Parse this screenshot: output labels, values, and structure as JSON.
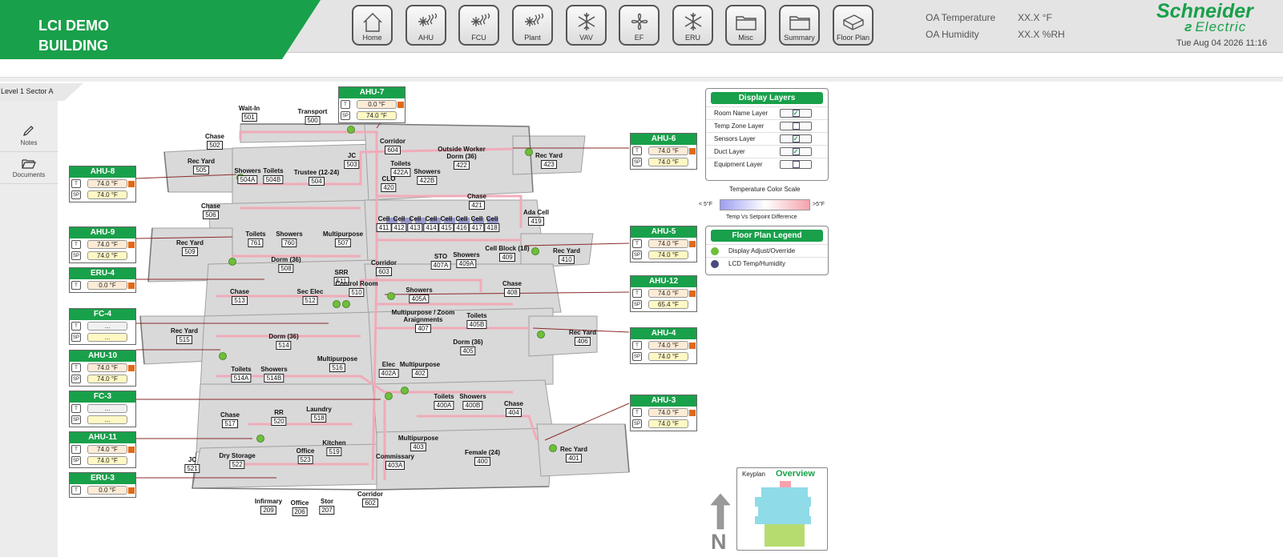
{
  "brand": {
    "line1": "LCI DEMO",
    "line2": "BUILDING"
  },
  "nav": [
    {
      "label": "Home",
      "icon": "home-icon"
    },
    {
      "label": "AHU",
      "icon": "snowflake-heat-icon"
    },
    {
      "label": "FCU",
      "icon": "snowflake-heat-icon"
    },
    {
      "label": "Plant",
      "icon": "snowflake-heat-icon"
    },
    {
      "label": "VAV",
      "icon": "snowflake-icon"
    },
    {
      "label": "EF",
      "icon": "fan-icon"
    },
    {
      "label": "ERU",
      "icon": "snowflake-icon"
    },
    {
      "label": "Misc",
      "icon": "folder-icon"
    },
    {
      "label": "Summary",
      "icon": "folder-icon"
    },
    {
      "label": "Floor Plan",
      "icon": "floor-plan-icon"
    }
  ],
  "oa": {
    "temp_label": "OA Temperature",
    "temp_value": "XX.X °F",
    "hum_label": "OA Humidity",
    "hum_value": "XX.X %RH"
  },
  "logo": {
    "line1": "Schneider",
    "line2": "Electric"
  },
  "datetime": "Tue Aug 04 2026 11:16",
  "breadcrumb": "Level 1 Sector A",
  "side": [
    {
      "label": "Notes",
      "icon": "pencil-icon"
    },
    {
      "label": "Documents",
      "icon": "folder-open-icon"
    }
  ],
  "equipment": [
    {
      "id": "ahu7",
      "name": "AHU-7",
      "t": "0.0 °F",
      "sp": "74.0 °F"
    },
    {
      "id": "ahu8",
      "name": "AHU-8",
      "t": "74.0 °F",
      "sp": "74.0 °F"
    },
    {
      "id": "ahu9",
      "name": "AHU-9",
      "t": "74.0 °F",
      "sp": "74.0 °F"
    },
    {
      "id": "eru4",
      "name": "ERU-4",
      "t": "0.0 °F"
    },
    {
      "id": "fc4",
      "name": "FC-4",
      "t": "...",
      "sp": "..."
    },
    {
      "id": "ahu10",
      "name": "AHU-10",
      "t": "74.0 °F",
      "sp": "74.0 °F"
    },
    {
      "id": "fc3",
      "name": "FC-3",
      "t": "...",
      "sp": "..."
    },
    {
      "id": "ahu11",
      "name": "AHU-11",
      "t": "74.0 °F",
      "sp": "74.0 °F"
    },
    {
      "id": "eru3",
      "name": "ERU-3",
      "t": "0.0 °F"
    },
    {
      "id": "ahu6",
      "name": "AHU-6",
      "t": "74.0 °F",
      "sp": "74.0 °F"
    },
    {
      "id": "ahu5",
      "name": "AHU-5",
      "t": "74.0 °F",
      "sp": "74.0 °F"
    },
    {
      "id": "ahu12",
      "name": "AHU-12",
      "t": "74.0 °F",
      "sp": "65.4 °F"
    },
    {
      "id": "ahu4",
      "name": "AHU-4",
      "t": "74.0 °F",
      "sp": "74.0 °F"
    },
    {
      "id": "ahu3",
      "name": "AHU-3",
      "t": "74.0 °F",
      "sp": "74.0 °F"
    }
  ],
  "tags": {
    "t": "T",
    "sp": "SP"
  },
  "rooms": [
    {
      "name": "Wait-In",
      "num": "501"
    },
    {
      "name": "Transport",
      "num": "500"
    },
    {
      "name": "Chase",
      "num": "502"
    },
    {
      "name": "Corridor",
      "num": "604"
    },
    {
      "name": "Outside Worker Dorm (36)",
      "num": "422"
    },
    {
      "name": "Rec Yard",
      "num": "423"
    },
    {
      "name": "Rec Yard",
      "num": "505"
    },
    {
      "name": "Showers",
      "num": "504A"
    },
    {
      "name": "Toilets",
      "num": "504B"
    },
    {
      "name": "Trustee (12-24)",
      "num": "504"
    },
    {
      "name": "JC",
      "num": "503"
    },
    {
      "name": "Toilets",
      "num": "422A"
    },
    {
      "name": "Showers",
      "num": "422B"
    },
    {
      "name": "CLO",
      "num": "420"
    },
    {
      "name": "Chase",
      "num": "421"
    },
    {
      "name": "Chase",
      "num": "506"
    },
    {
      "name": "Cell",
      "num": "411"
    },
    {
      "name": "Cell",
      "num": "412"
    },
    {
      "name": "Cell",
      "num": "413"
    },
    {
      "name": "Cell",
      "num": "414"
    },
    {
      "name": "Cell",
      "num": "415"
    },
    {
      "name": "Cell",
      "num": "416"
    },
    {
      "name": "Cell",
      "num": "417"
    },
    {
      "name": "Cell",
      "num": "418"
    },
    {
      "name": "Ada Cell",
      "num": "419"
    },
    {
      "name": "Toilets",
      "num": "761"
    },
    {
      "name": "Showers",
      "num": "760"
    },
    {
      "name": "Multipurpose",
      "num": "507"
    },
    {
      "name": "Rec Yard",
      "num": "509"
    },
    {
      "name": "Dorm (36)",
      "num": "508"
    },
    {
      "name": "STO",
      "num": "407A"
    },
    {
      "name": "Showers",
      "num": "409A"
    },
    {
      "name": "Cell Block (18)",
      "num": "409"
    },
    {
      "name": "Rec Yard",
      "num": "410"
    },
    {
      "name": "Corridor",
      "num": "603"
    },
    {
      "name": "SRR",
      "num": "511"
    },
    {
      "name": "Chase",
      "num": "513"
    },
    {
      "name": "Sec Elec",
      "num": "512"
    },
    {
      "name": "Control Room",
      "num": "510"
    },
    {
      "name": "Showers",
      "num": "405A"
    },
    {
      "name": "Chase",
      "num": "408"
    },
    {
      "name": "Multipurpose / Zoom Araignments",
      "num": "407"
    },
    {
      "name": "Toilets",
      "num": "405B"
    },
    {
      "name": "Rec Yard",
      "num": "515"
    },
    {
      "name": "Dorm (36)",
      "num": "514"
    },
    {
      "name": "Rec Yard",
      "num": "406"
    },
    {
      "name": "Dorm (36)",
      "num": "405"
    },
    {
      "name": "Multipurpose",
      "num": "516"
    },
    {
      "name": "Elec",
      "num": "402A"
    },
    {
      "name": "Multipurpose",
      "num": "402"
    },
    {
      "name": "Toilets",
      "num": "514A"
    },
    {
      "name": "Showers",
      "num": "514B"
    },
    {
      "name": "Toilets",
      "num": "400A"
    },
    {
      "name": "Showers",
      "num": "400B"
    },
    {
      "name": "Chase",
      "num": "404"
    },
    {
      "name": "Chase",
      "num": "517"
    },
    {
      "name": "RR",
      "num": "520"
    },
    {
      "name": "Laundry",
      "num": "518"
    },
    {
      "name": "Multipurpose",
      "num": "403"
    },
    {
      "name": "Kitchen",
      "num": "519"
    },
    {
      "name": "Office",
      "num": "523"
    },
    {
      "name": "JC",
      "num": "521"
    },
    {
      "name": "Dry Storage",
      "num": "522"
    },
    {
      "name": "Commissary",
      "num": "403A"
    },
    {
      "name": "Female (24)",
      "num": "400"
    },
    {
      "name": "Rec Yard",
      "num": "401"
    },
    {
      "name": "Infirmary",
      "num": "209"
    },
    {
      "name": "Office",
      "num": "206"
    },
    {
      "name": "Stor",
      "num": "207"
    },
    {
      "name": "Corridor",
      "num": "602"
    }
  ],
  "display_layers": {
    "title": "Display Layers",
    "items": [
      {
        "label": "Room Name Layer",
        "checked": true
      },
      {
        "label": "Temp Zone Layer",
        "checked": false
      },
      {
        "label": "Sensors Layer",
        "checked": true
      },
      {
        "label": "Duct Layer",
        "checked": true
      },
      {
        "label": "Equipment Layer",
        "checked": false
      }
    ]
  },
  "temp_scale": {
    "title": "Temperature Color Scale",
    "min_label": "< 5°F",
    "max_label": ">5°F",
    "caption": "Temp Vs Setpoint Difference",
    "color_low": "#9d9df2",
    "color_high": "#f4a3ad"
  },
  "legend": {
    "title": "Floor Plan Legend",
    "items": [
      {
        "label": "Display Adjust/Override",
        "color": "#6fbf3a"
      },
      {
        "label": "LCD Temp/Humidity",
        "color": "#4a4a7c"
      }
    ]
  },
  "keyplan": {
    "label": "Keyplan",
    "title": "Overview"
  },
  "north": "N",
  "colors": {
    "accent": "#19a04a",
    "duct": "#f2a9b7",
    "alarm": "#e06a1a"
  }
}
